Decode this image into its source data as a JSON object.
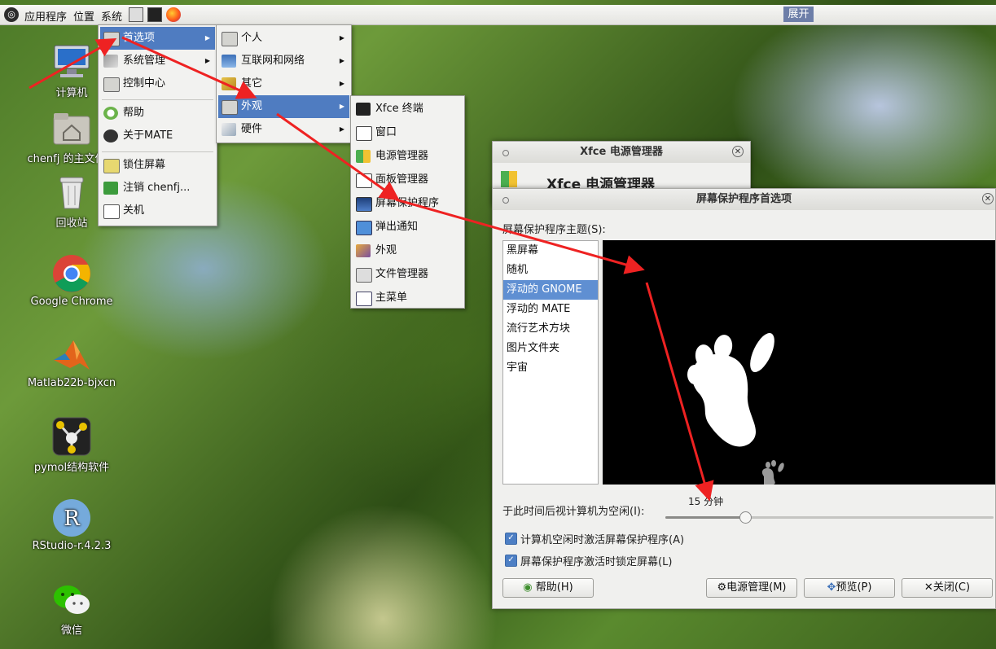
{
  "panel": {
    "menu_apps": "应用程序",
    "menu_places": "位置",
    "menu_system": "系统",
    "expand": "展开"
  },
  "desktop_icons": [
    {
      "label": "计算机",
      "icon": "computer-icon"
    },
    {
      "label": "chenfj 的主文件夹",
      "icon": "home-folder-icon"
    },
    {
      "label": "回收站",
      "icon": "trash-icon"
    },
    {
      "label": "Google Chrome",
      "icon": "chrome-icon"
    },
    {
      "label": "Matlab22b-bjxcn",
      "icon": "matlab-icon"
    },
    {
      "label": "pymol结构软件",
      "icon": "pymol-icon"
    },
    {
      "label": "RStudio-r.4.2.3",
      "icon": "rstudio-icon"
    },
    {
      "label": "微信",
      "icon": "wechat-icon"
    }
  ],
  "system_menu": {
    "items": [
      "首选项",
      "系统管理",
      "控制中心",
      "帮助",
      "关于MATE",
      "锁住屏幕",
      "注销 chenfj...",
      "关机"
    ]
  },
  "prefs_menu": {
    "items": [
      "个人",
      "互联网和网络",
      "其它",
      "外观",
      "硬件"
    ]
  },
  "appearance_menu": {
    "items": [
      "Xfce 终端",
      "窗口",
      "电源管理器",
      "面板管理器",
      "屏幕保护程序",
      "弹出通知",
      "外观",
      "文件管理器",
      "主菜单"
    ]
  },
  "power_window": {
    "title": "Xfce 电源管理器",
    "heading": "Xfce 电源管理器"
  },
  "screensaver_window": {
    "title": "屏幕保护程序首选项",
    "theme_label": "屏幕保护程序主题(S):",
    "themes": [
      "黑屏幕",
      "随机",
      "浮动的 GNOME",
      "浮动的 MATE",
      "流行艺术方块",
      "图片文件夹",
      "宇宙"
    ],
    "selected_theme": "浮动的 GNOME",
    "idle_label": "于此时间后视计算机为空闲(I):",
    "idle_value": "15 分钟",
    "idle_minutes": 15,
    "check_activate": "计算机空闲时激活屏幕保护程序(A)",
    "check_lock": "屏幕保护程序激活时锁定屏幕(L)",
    "btn_help": "帮助(H)",
    "btn_power": "电源管理(M)",
    "btn_preview": "预览(P)",
    "btn_close": "关闭(C)"
  }
}
